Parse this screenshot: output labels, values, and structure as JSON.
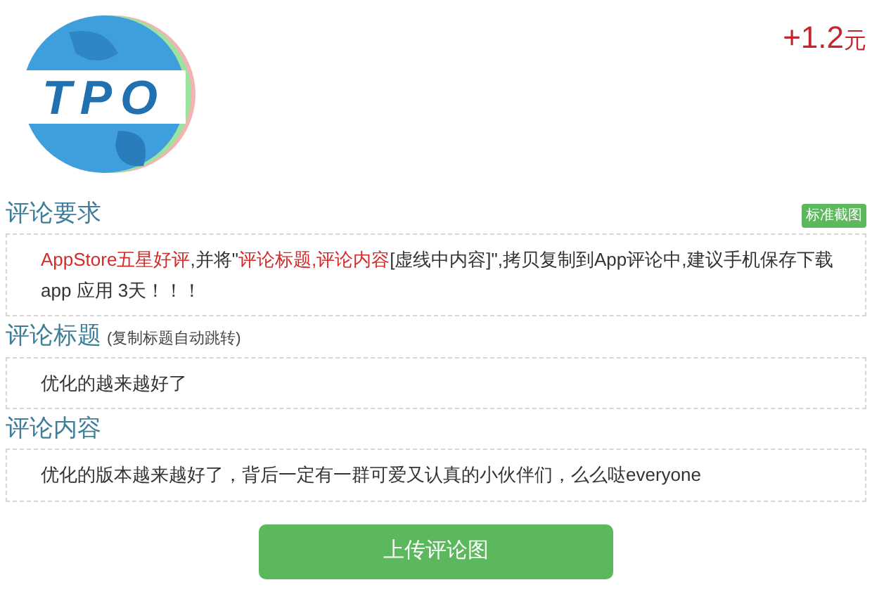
{
  "header": {
    "logo_text": "TPO",
    "reward": {
      "amount": "+1.2",
      "unit": "元"
    }
  },
  "sections": [
    {
      "title": "评论要求",
      "badge": "标准截图",
      "segments": [
        {
          "text": "AppStore五星好评",
          "highlight": true
        },
        {
          "text": ",并将\"",
          "highlight": false
        },
        {
          "text": "评论标题,评论内容",
          "highlight": true
        },
        {
          "text": "[虚线中内容]\",拷贝复制到App评论中,建议手机保存下载 app 应用 3天！！！",
          "highlight": false
        }
      ]
    },
    {
      "title": "评论标题",
      "note": "(复制标题自动跳转)",
      "segments": [
        {
          "text": "优化的越来越好了",
          "highlight": false
        }
      ]
    },
    {
      "title": "评论内容",
      "segments": [
        {
          "text": "优化的版本越来越好了，背后一定有一群可爱又认真的小伙伴们，么么哒everyone",
          "highlight": false
        }
      ]
    }
  ],
  "upload_button": "上传评论图"
}
